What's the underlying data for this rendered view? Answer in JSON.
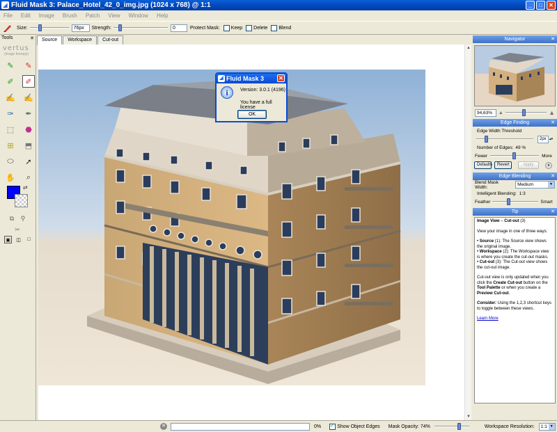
{
  "window": {
    "title": "Fluid Mask 3: Palace_Hotel_42_0_img.jpg (1024 x 768) @ 1:1"
  },
  "menu": [
    "File",
    "Edit",
    "Image",
    "Brush",
    "Patch",
    "View",
    "Window",
    "Help"
  ],
  "toolbar": {
    "size_label": "Size:",
    "size_value": "76px",
    "strength_label": "Strength:",
    "strength_value": "0",
    "protect_label": "Protect Mask:",
    "keep_label": "Keep",
    "delete_label": "Delete",
    "blend_label": "Blend",
    "size_level": 0.25,
    "strength_level": 0.1
  },
  "tools_panel": {
    "title": "Tools",
    "logo": "vertus",
    "logo_sub": "(image therapy)"
  },
  "tabs": [
    {
      "label": "Source",
      "active": true
    },
    {
      "label": "Workspace",
      "active": false
    },
    {
      "label": "Cut-out",
      "active": false
    }
  ],
  "dialog": {
    "title": "Fluid Mask 3",
    "version": "Version: 3.0.1 (4196)",
    "license": "You have a full license",
    "ok": "OK"
  },
  "navigator": {
    "title": "Navigator",
    "zoom": "94,63%",
    "zoom_level": 0.45
  },
  "edge_finding": {
    "title": "Edge Finding",
    "threshold_label": "Edge Width Threshold",
    "threshold_value": "2px",
    "threshold_level": 0.15,
    "edges_label": "Number of Edges:",
    "edges_value": "49 %",
    "edges_level": 0.49,
    "fewer": "Fewer",
    "more": "More",
    "defaults": "Defaults",
    "revert": "Revert",
    "apply": "Apply"
  },
  "edge_blending": {
    "title": "Edge Blending",
    "blend_width_label": "Blend Mask Width:",
    "blend_width_value": "Medium",
    "intelligent_label": "Intelligent Blending:",
    "intelligent_value": "1:3",
    "feather": "Feather",
    "smart": "Smart",
    "blend_level": 0.33
  },
  "tip": {
    "title": "Tip",
    "heading_bold": "Image View",
    "heading_dash": " – ",
    "heading_rest": "Cut-out",
    "heading_num": " (3)",
    "intro": "View your image in one of three ways:",
    "b1_name": "Source",
    "b1_text": " (1): The Source view shows the original image.",
    "b2_name": "Workspace",
    "b2_text": " (2): The Workspace view is where you create the cut-out masks.",
    "b3_name": "Cut-out",
    "b3_text": " (3): The Cut-out view shows the cut-out image.",
    "p1a": "Cut-out view is only updated when you click the ",
    "p1b": "Create Cut-out",
    "p1c": " button on the ",
    "p1d": "Tool Palette",
    "p1e": " or when you create a ",
    "p1f": "Preview Cut-out",
    "p1g": ".",
    "consider": "Consider:",
    "consider_text": " Using the 1,2,3 shortcut keys to toggle between these views.",
    "link": "Learn More"
  },
  "status": {
    "progress_text": "0%",
    "show_edges": "Show Object Edges",
    "mask_opacity": "Mask Opacity: 74%",
    "opacity_level": 0.74,
    "workspace_res_label": "Workspace Resolution:",
    "workspace_res_value": "1:1"
  },
  "colors": {
    "title_bar": "#0a5fd8",
    "panel_header": "#5a8cd8",
    "foreground": "#0000ff"
  }
}
